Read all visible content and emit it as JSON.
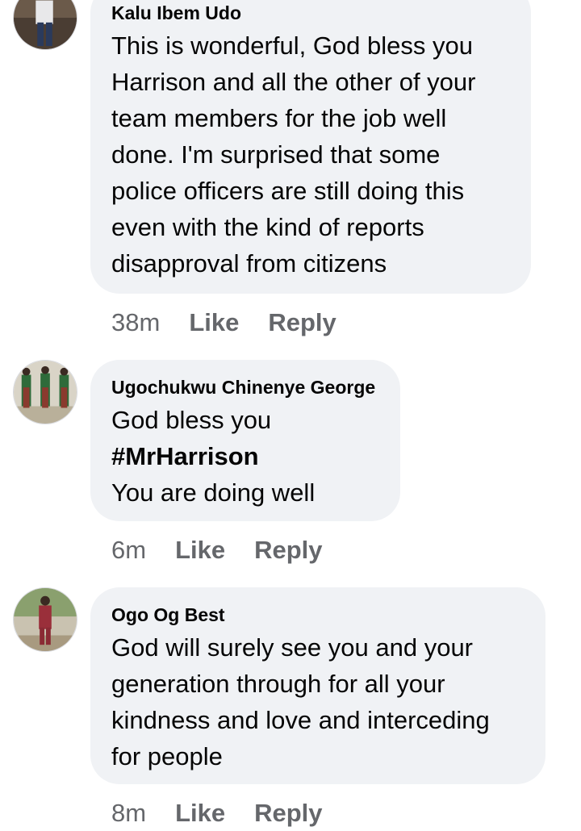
{
  "comments": [
    {
      "author": "Kalu Ibem Udo",
      "text": "This is wonderful, God bless you Harrison and all the other of your team members for the job well done. I'm surprised that some police officers are still doing this even with the kind of reports disapproval from citizens",
      "time": "38m",
      "like_label": "Like",
      "reply_label": "Reply"
    },
    {
      "author": "Ugochukwu Chinenye George",
      "text_line1": "God bless you",
      "hashtag": "#MrHarrison",
      "text_line2": "You are doing well",
      "time": "6m",
      "like_label": "Like",
      "reply_label": "Reply"
    },
    {
      "author": "Ogo Og Best",
      "text": "God will surely see you and your generation through for all your kindness and love and interceding for people",
      "time": "8m",
      "like_label": "Like",
      "reply_label": "Reply"
    }
  ]
}
